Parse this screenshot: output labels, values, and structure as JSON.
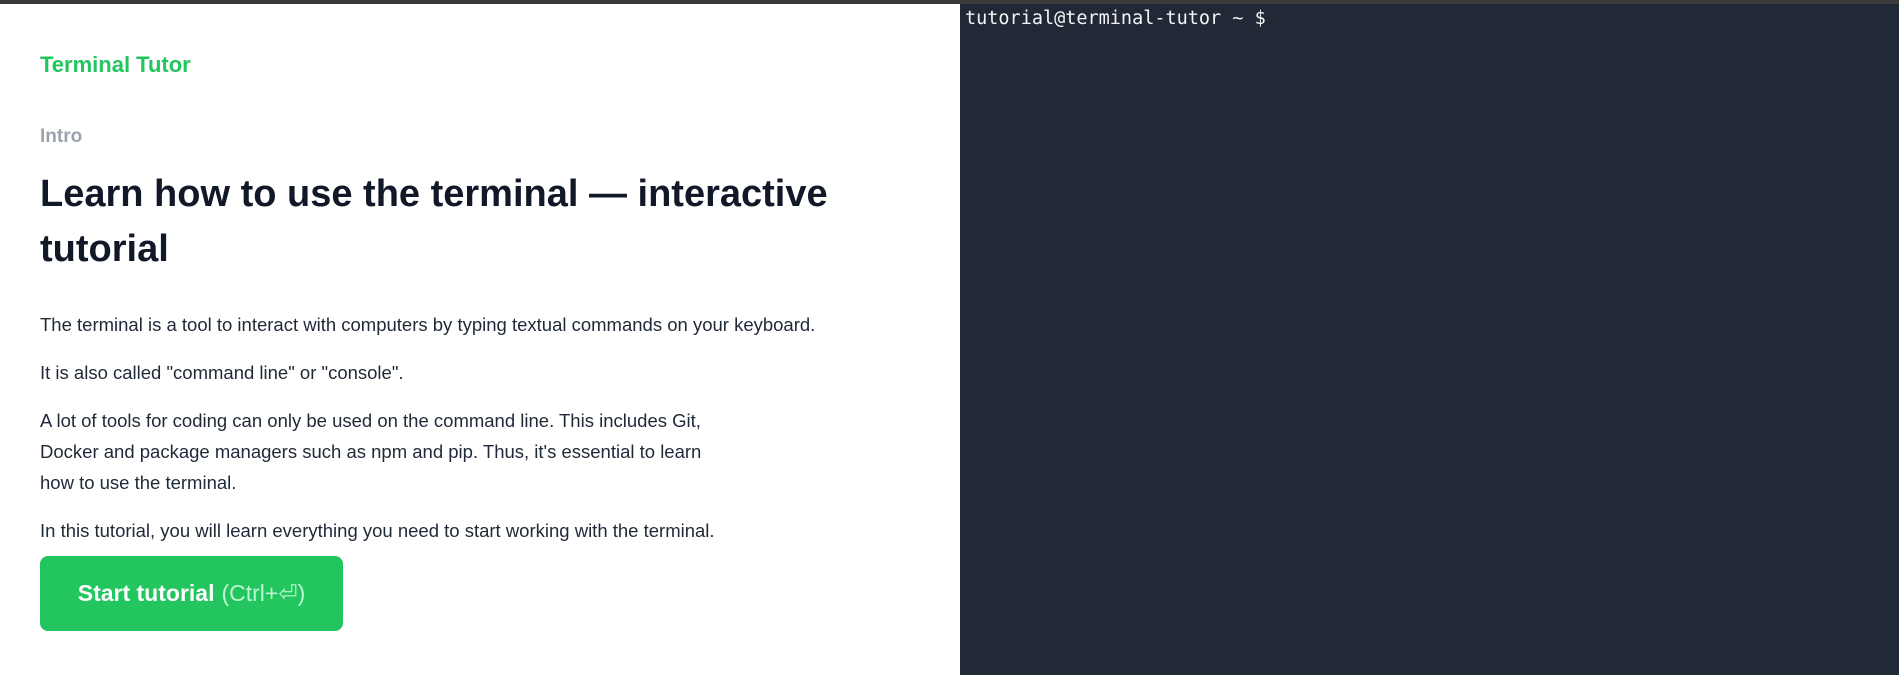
{
  "app": {
    "brand": "Terminal Tutor"
  },
  "lesson": {
    "section": "Intro",
    "title": "Learn how to use the terminal — interactive tutorial",
    "paragraphs": [
      "The terminal is a tool to interact with computers by typing textual commands on your keyboard.",
      "It is also called \"command line\" or \"console\".",
      "A lot of tools for coding can only be used on the command line. This includes Git, Docker and package managers such as npm and pip. Thus, it's essential to learn how to use the terminal.",
      "In this tutorial, you will learn everything you need to start working with the terminal."
    ],
    "start_button": {
      "label": "Start tutorial",
      "shortcut": "(Ctrl+⏎)"
    }
  },
  "terminal": {
    "prompt": "tutorial@terminal-tutor ~ $"
  },
  "colors": {
    "accent": "#22c55e",
    "terminal_bg": "#212937"
  }
}
